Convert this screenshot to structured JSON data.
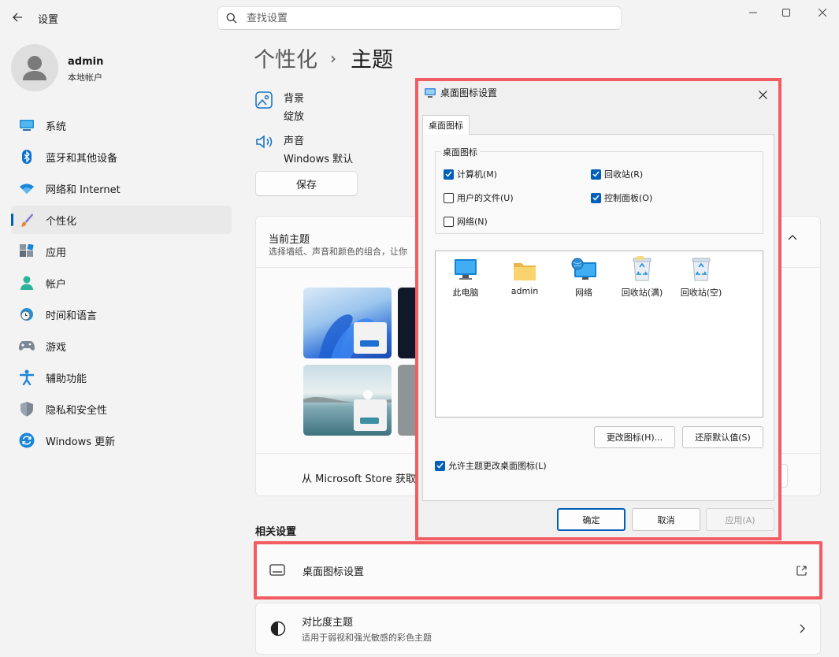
{
  "app": {
    "title": "设置"
  },
  "search": {
    "placeholder": "查找设置"
  },
  "profile": {
    "name": "admin",
    "account_type": "本地帐户"
  },
  "nav": {
    "items": [
      {
        "label": "系统",
        "icon": "monitor-icon"
      },
      {
        "label": "蓝牙和其他设备",
        "icon": "bluetooth-icon"
      },
      {
        "label": "网络和 Internet",
        "icon": "wifi-icon"
      },
      {
        "label": "个性化",
        "icon": "brush-icon",
        "active": true
      },
      {
        "label": "应用",
        "icon": "apps-icon"
      },
      {
        "label": "帐户",
        "icon": "person-icon"
      },
      {
        "label": "时间和语言",
        "icon": "globe-clock-icon"
      },
      {
        "label": "游戏",
        "icon": "gamepad-icon"
      },
      {
        "label": "辅助功能",
        "icon": "accessibility-icon"
      },
      {
        "label": "隐私和安全性",
        "icon": "shield-icon"
      },
      {
        "label": "Windows 更新",
        "icon": "update-icon"
      }
    ]
  },
  "breadcrumb": {
    "parent": "个性化",
    "separator": "›",
    "current": "主题"
  },
  "theme_settings": {
    "background": {
      "title": "背景",
      "value": "绽放"
    },
    "sound": {
      "title": "声音",
      "value": "Windows 默认"
    },
    "save_label": "保存"
  },
  "current_theme": {
    "title": "当前主题",
    "subtitle": "选择墙纸、声音和颜色的组合，让你",
    "store_text": "从 Microsoft Store 获取"
  },
  "related": {
    "heading": "相关设置",
    "desktop_icons": {
      "title": "桌面图标设置"
    },
    "contrast": {
      "title": "对比度主题",
      "subtitle": "适用于弱视和强光敏感的彩色主题"
    }
  },
  "dialog": {
    "title": "桌面图标设置",
    "tab": "桌面图标",
    "group_label": "桌面图标",
    "checkboxes": [
      {
        "label": "计算机(M)",
        "checked": true
      },
      {
        "label": "回收站(R)",
        "checked": true
      },
      {
        "label": "用户的文件(U)",
        "checked": false
      },
      {
        "label": "控制面板(O)",
        "checked": true
      },
      {
        "label": "网络(N)",
        "checked": false
      }
    ],
    "icons": [
      {
        "label": "此电脑",
        "icon": "pc-icon"
      },
      {
        "label": "admin",
        "icon": "folder-icon"
      },
      {
        "label": "网络",
        "icon": "network-icon"
      },
      {
        "label": "回收站(满)",
        "icon": "recycle-bin-full-icon"
      },
      {
        "label": "回收站(空)",
        "icon": "recycle-bin-empty-icon"
      }
    ],
    "change_icon_label": "更改图标(H)...",
    "restore_default_label": "还原默认值(S)",
    "allow_theme_label": "允许主题更改桌面图标(L)",
    "allow_theme_checked": true,
    "ok_label": "确定",
    "cancel_label": "取消",
    "apply_label": "应用(A)"
  },
  "colors": {
    "accent": "#005fb8",
    "highlight": "#f25c63"
  }
}
